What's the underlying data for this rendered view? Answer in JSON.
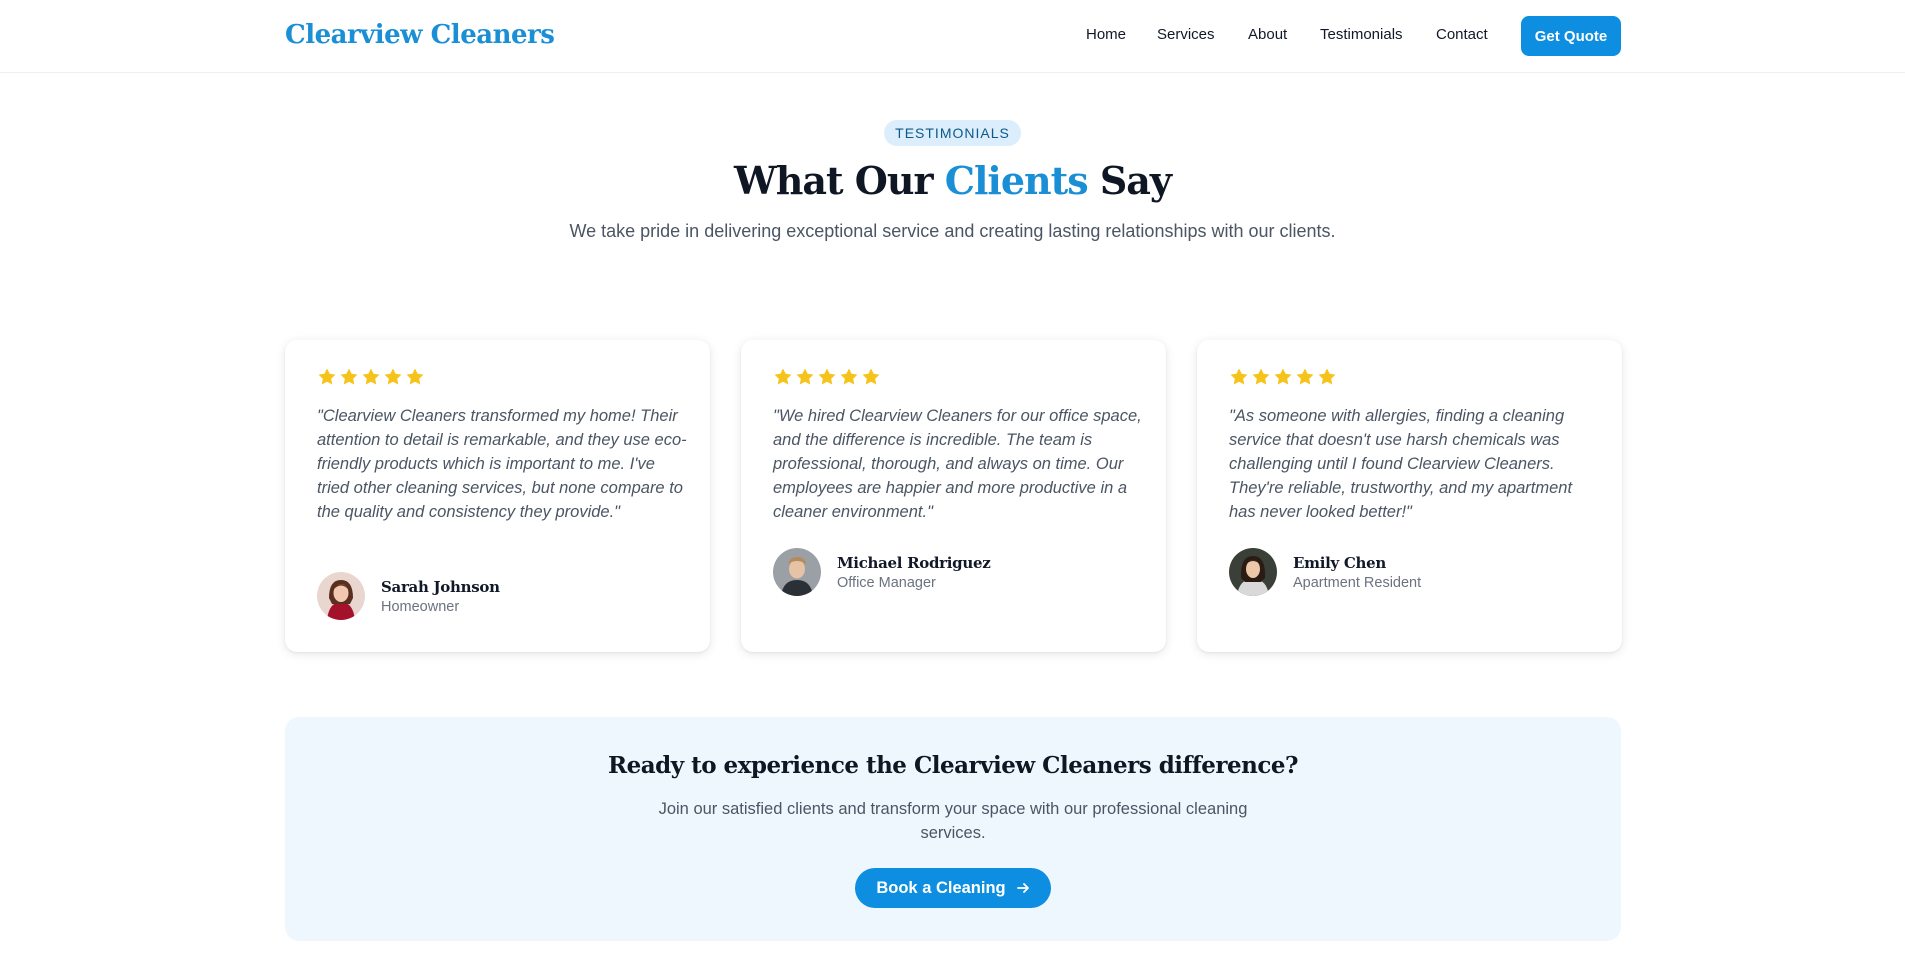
{
  "brand": {
    "name": "Clearview Cleaners",
    "accent": "#1a8fd6",
    "button_color": "#0d8ee0",
    "star_color": "#f6c31a"
  },
  "nav": {
    "items": [
      "Home",
      "Services",
      "About",
      "Testimonials",
      "Contact"
    ],
    "cta_label": "Get Quote"
  },
  "section": {
    "pill": "TESTIMONIALS",
    "title_prefix": "What Our",
    "title_accent": "Clients",
    "title_suffix": "Say",
    "subtitle": "We take pride in delivering exceptional service and creating lasting relationships with our clients."
  },
  "testimonials": [
    {
      "rating": 5,
      "quote": "\"Clearview Cleaners transformed my home! Their attention to detail is remarkable, and they use eco-friendly products which is important to me. I've tried other cleaning services, but none compare to the quality and consistency they provide.\"",
      "name": "Sarah Johnson",
      "role": "Homeowner"
    },
    {
      "rating": 5,
      "quote": "\"We hired Clearview Cleaners for our office space, and the difference is incredible. The team is professional, thorough, and always on time. Our employees are happier and more productive in a cleaner environment.\"",
      "name": "Michael Rodriguez",
      "role": "Office Manager"
    },
    {
      "rating": 5,
      "quote": "\"As someone with allergies, finding a cleaning service that doesn't use harsh chemicals was challenging until I found Clearview Cleaners. They're reliable, trustworthy, and my apartment has never looked better!\"",
      "name": "Emily Chen",
      "role": "Apartment Resident"
    }
  ],
  "cta": {
    "title": "Ready to experience the Clearview Cleaners difference?",
    "text": "Join our satisfied clients and transform your space with our professional cleaning services.",
    "button_label": "Book a Cleaning",
    "button_icon": "arrow-right-icon"
  }
}
